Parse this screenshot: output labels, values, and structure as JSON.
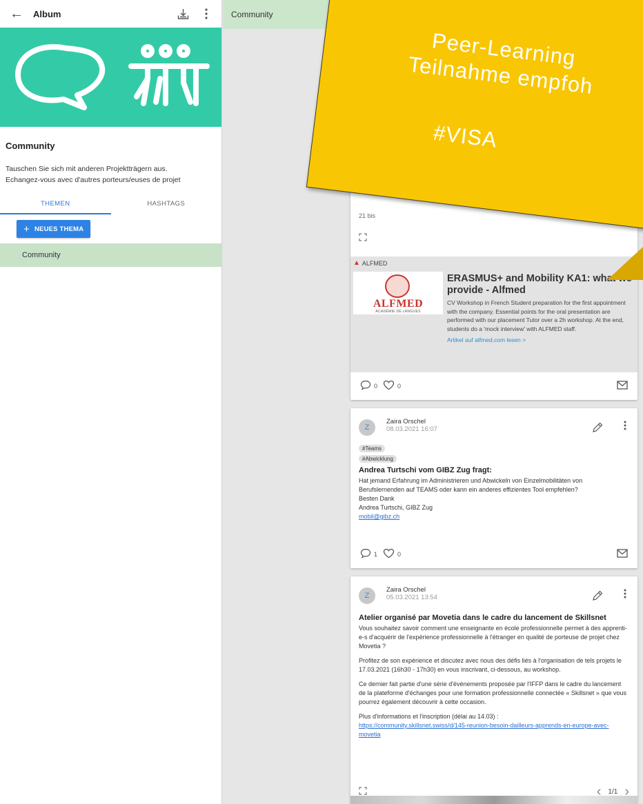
{
  "left_panel": {
    "header_title": "Album",
    "community_title": "Community",
    "description_de": "Tauschen Sie sich mit anderen Projektträgern aus.",
    "description_fr": "Echangez-vous avec d'autres porteurs/euses de projet",
    "tabs": [
      {
        "label": "THEMEN",
        "active": true
      },
      {
        "label": "HASHTAGS",
        "active": false
      }
    ],
    "new_topic_button": "NEUES THEMA",
    "topics": [
      {
        "label": "Community",
        "selected": true
      }
    ],
    "accent_color": "#2d82e5",
    "banner_color": "#33cba7"
  },
  "topbar": {
    "title": "Community"
  },
  "sticky_note": {
    "lines": [
      "Peer-Learning",
      "Teilnahme empfoh",
      "#VISA"
    ],
    "color": "#f9c604"
  },
  "feed": {
    "card1": {
      "partial_text": "21 bis",
      "preview": {
        "source": "ALFMED",
        "logo_text": "ALFMED",
        "logo_subtext": "ACADÉMIE DE LANGUES",
        "title": "ERASMUS+ and Mobility KA1: what we provide - Alfmed",
        "text": "CV Workshop in French Student preparation for the first appointment with the company. Essential points for the oral presentation are performed with our placement Tutor over a 2h workshop. At the end, students do a 'mock interview' with ALFMED staff.",
        "link": "Artikel auf alfmed.com lesen >"
      },
      "comments": "0",
      "likes": "0"
    },
    "card2": {
      "avatar": "Z",
      "author": "Zaira Orschel",
      "time": "08.03.2021 16:07",
      "tags": [
        "#Teams",
        "#Abwicklung"
      ],
      "title": "Andrea Turtschi vom GIBZ Zug fragt:",
      "lines": [
        "Hat jemand Erfahrung im Administrieren und Abwickeln von Einzelmobilitäten von Berufslernenden auf TEAMS oder kann ein anderes effizientes Tool empfehlen?",
        "Besten Dank",
        "Andrea Turtschi, GIBZ Zug"
      ],
      "email": "mobil@gibz.ch",
      "comments": "1",
      "likes": "0"
    },
    "card3": {
      "avatar": "Z",
      "author": "Zaira Orschel",
      "time": "05.03.2021 13:54",
      "title": "Atelier organisé par Movetia dans le cadre du lancement de Skillsnet",
      "paragraphs": [
        "Vous souhaitez savoir comment une enseignante en école professionnelle permet à des apprenti-e-s d'acquérir de l'expérience professionnelle à l'étranger en qualité de porteuse de projet chez Movetia ?",
        "Profitez de son expérience et discutez avec nous des défis liés à l'organisation de tels projets le 17.03.2021 (16h30 - 17h30) en vous inscrivant, ci-dessous, au workshop.",
        "Ce dernier fait partie d'une série d'événements proposée par l'IFFP dans le cadre du lancement de la plateforme d'échanges pour une formation professionnelle connectée « Skillsnet » que vous pourrez également découvrir à cette occasion.",
        "Plus d'informations et l'inscription (délai au 14.03) :"
      ],
      "link": "https://community.skillsnet.swiss/d/145-reunion-besoin-dailleurs-apprends-en-europe-avec-movetia",
      "pager": "1/1"
    }
  }
}
